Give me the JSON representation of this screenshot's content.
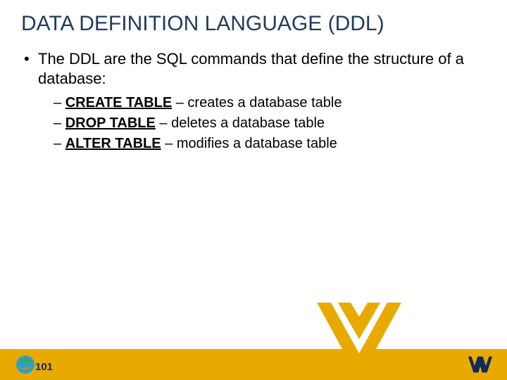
{
  "title": "DATA DEFINITION LANGUAGE (DDL)",
  "intro": "The DDL are the SQL commands that define the structure of a database:",
  "commands": [
    {
      "name": "CREATE TABLE",
      "desc": " – creates a database table"
    },
    {
      "name": "DROP TABLE",
      "desc": " – deletes a database table"
    },
    {
      "name": "ALTER TABLE",
      "desc": " – modifies a database table"
    }
  ],
  "colors": {
    "title": "#1f3b5c",
    "accent": "#e9aa00",
    "wv_navy": "#0f2b5b",
    "wv_gold": "#e9aa00",
    "globe_blue": "#2aa3c7",
    "globe_green": "#4aa13a",
    "globe_orange": "#e77b1f"
  }
}
